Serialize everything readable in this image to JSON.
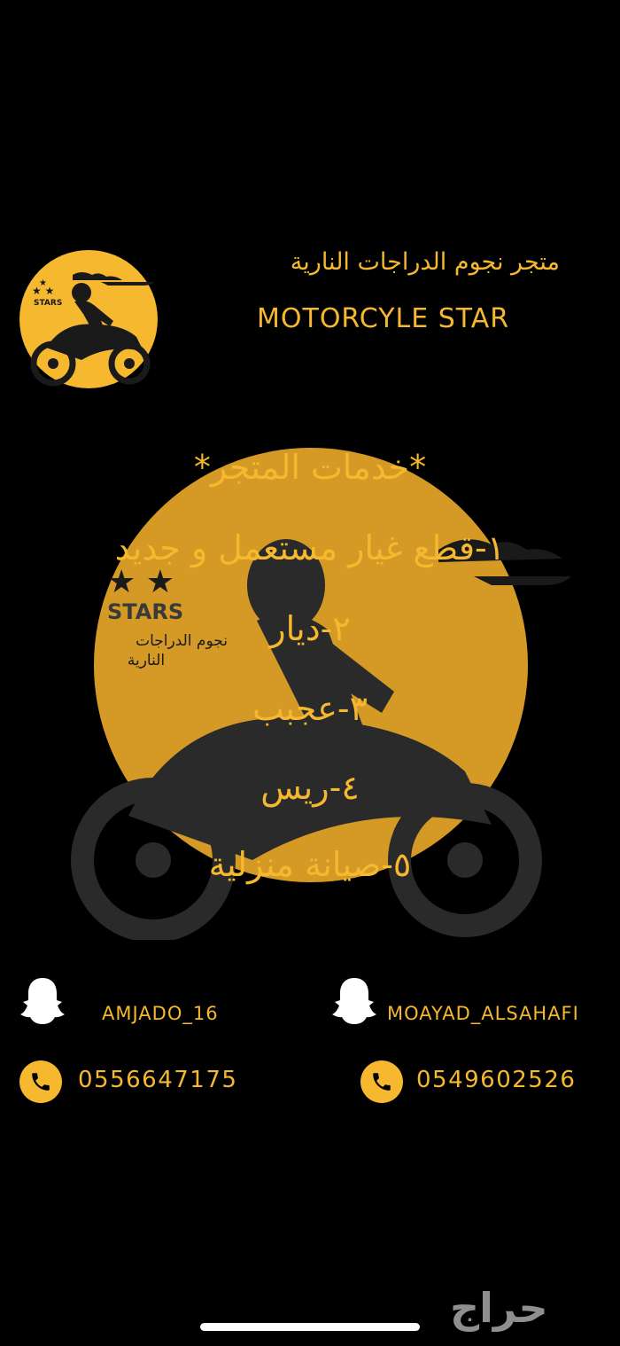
{
  "header": {
    "store_name_ar": "متجر نجوم الدراجات النارية",
    "store_name_en": "MOTORCYLE STAR",
    "logo_text": "STARS",
    "logo_subtext": "نجوم الدراجات النارية"
  },
  "services": {
    "title": "*خدمات المتجر*",
    "items": [
      "١-قطع غيار مستعمل و جديد",
      "٢-ديار",
      "٣-عجبب",
      "٤-ريس",
      "٥-صيانة منزلية"
    ]
  },
  "emblem": {
    "text": "STARS",
    "subtext_line1": "نجوم الدراجات",
    "subtext_line2": "النارية"
  },
  "contacts": {
    "left": {
      "snapchat": "AMJADO_16",
      "phone": "0556647175"
    },
    "right": {
      "snapchat": "MOAYAD_ALSAHAFI",
      "phone": "0549602526"
    }
  },
  "watermark": "حراج",
  "colors": {
    "accent": "#f5b82e",
    "background": "#000000"
  },
  "icons": [
    "snapchat-ghost-icon",
    "phone-icon",
    "motorcycle-rider-logo"
  ]
}
